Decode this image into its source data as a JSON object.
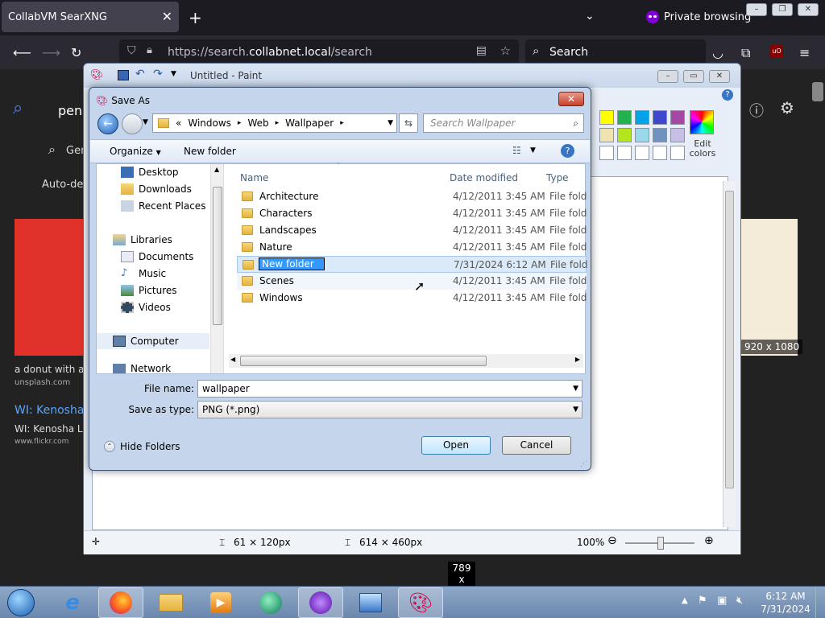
{
  "browser": {
    "tab_title": "CollabVM SearXNG",
    "tab_close": "✕",
    "new_tab": "+",
    "tab_list": "⌄",
    "private_label": "Private browsing",
    "url_prefix": "https://search.",
    "url_host": "collabnet.local",
    "url_path": "/search",
    "search_placeholder": "Search",
    "min": "–",
    "max": "❐",
    "close": "✕"
  },
  "page": {
    "query_text": "peni",
    "general_label": "Gen",
    "auto_detect": "Auto-det",
    "result1_text": "a donut with a",
    "result1_site": "unsplash.com",
    "result2_title": "WI: Kenosha",
    "result2_sub": "WI: Kenosha L",
    "result2_site": "www.flickr.com",
    "img_dims": "920 x 1080"
  },
  "paint": {
    "title": "Untitled - Paint",
    "edit_colors": "Edit\ncolors",
    "status_pos": "61 × 120px",
    "status_size": "614 × 460px",
    "zoom": "100%",
    "swatch_colors": [
      "#ffff00",
      "#22b14c",
      "#00a2e8",
      "#3f48cc",
      "#a349a4",
      "#efe4b0",
      "#b5e61d",
      "#99d9ea",
      "#7092be",
      "#c8bfe7"
    ]
  },
  "dialog": {
    "title": "Save As",
    "close": "✕",
    "breadcrumb": [
      "«",
      "Windows",
      "Web",
      "Wallpaper"
    ],
    "search_placeholder": "Search Wallpaper",
    "organize": "Organize",
    "new_folder": "New folder",
    "nav": {
      "desktop": "Desktop",
      "downloads": "Downloads",
      "recent": "Recent Places",
      "libraries": "Libraries",
      "documents": "Documents",
      "music": "Music",
      "pictures": "Pictures",
      "videos": "Videos",
      "computer": "Computer",
      "network": "Network"
    },
    "columns": {
      "name": "Name",
      "date": "Date modified",
      "type": "Type"
    },
    "files": [
      {
        "name": "Architecture",
        "date": "4/12/2011 3:45 AM",
        "type": "File folder"
      },
      {
        "name": "Characters",
        "date": "4/12/2011 3:45 AM",
        "type": "File folder"
      },
      {
        "name": "Landscapes",
        "date": "4/12/2011 3:45 AM",
        "type": "File folder"
      },
      {
        "name": "Nature",
        "date": "4/12/2011 3:45 AM",
        "type": "File folder"
      },
      {
        "name": "New folder",
        "date": "7/31/2024 6:12 AM",
        "type": "File folder"
      },
      {
        "name": "Scenes",
        "date": "4/12/2011 3:45 AM",
        "type": "File folder"
      },
      {
        "name": "Windows",
        "date": "4/12/2011 3:45 AM",
        "type": "File folder"
      }
    ],
    "file_name_label": "File name:",
    "file_name_value": "wallpaper",
    "save_type_label": "Save as type:",
    "save_type_value": "PNG (*.png)",
    "hide_folders": "Hide Folders",
    "open_button": "Open",
    "cancel_button": "Cancel"
  },
  "tooltip": {
    "line1": "789",
    "line2": "x"
  },
  "taskbar": {
    "time": "6:12 AM",
    "date": "7/31/2024"
  }
}
